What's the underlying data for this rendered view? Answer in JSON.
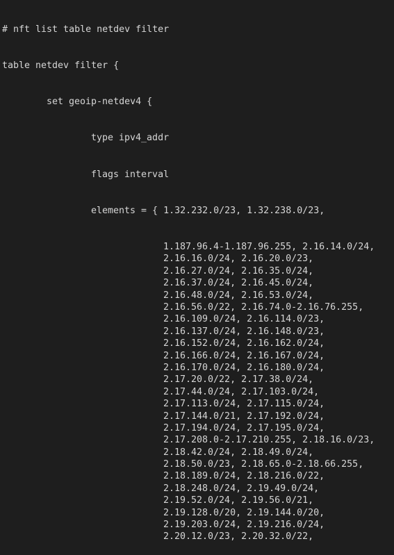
{
  "terminal": {
    "command": "# nft list table netdev filter",
    "table_header": "table netdev filter {",
    "set_header": "set geoip-netdev4 {",
    "type_line": "type ipv4_addr",
    "flags_line": "flags interval",
    "elements_first": "elements = { 1.32.232.0/23, 1.32.238.0/23,",
    "elements_continued": [
      "1.187.96.4-1.187.96.255, 2.16.14.0/24,",
      "2.16.16.0/24, 2.16.20.0/23,",
      "2.16.27.0/24, 2.16.35.0/24,",
      "2.16.37.0/24, 2.16.45.0/24,",
      "2.16.48.0/24, 2.16.53.0/24,",
      "2.16.56.0/22, 2.16.74.0-2.16.76.255,",
      "2.16.109.0/24, 2.16.114.0/23,",
      "2.16.137.0/24, 2.16.148.0/23,",
      "2.16.152.0/24, 2.16.162.0/24,",
      "2.16.166.0/24, 2.16.167.0/24,",
      "2.16.170.0/24, 2.16.180.0/24,",
      "2.17.20.0/22, 2.17.38.0/24,",
      "2.17.44.0/24, 2.17.103.0/24,",
      "2.17.113.0/24, 2.17.115.0/24,",
      "2.17.144.0/21, 2.17.192.0/24,",
      "2.17.194.0/24, 2.17.195.0/24,",
      "2.17.208.0-2.17.210.255, 2.18.16.0/23,",
      "2.18.42.0/24, 2.18.49.0/24,",
      "2.18.50.0/23, 2.18.65.0-2.18.66.255,",
      "2.18.189.0/24, 2.18.216.0/22,",
      "2.18.248.0/24, 2.19.49.0/24,",
      "2.19.52.0/24, 2.19.56.0/21,",
      "2.19.128.0/20, 2.19.144.0/20,",
      "2.19.203.0/24, 2.19.216.0/24,",
      "2.20.12.0/23, 2.20.32.0/22,"
    ]
  }
}
